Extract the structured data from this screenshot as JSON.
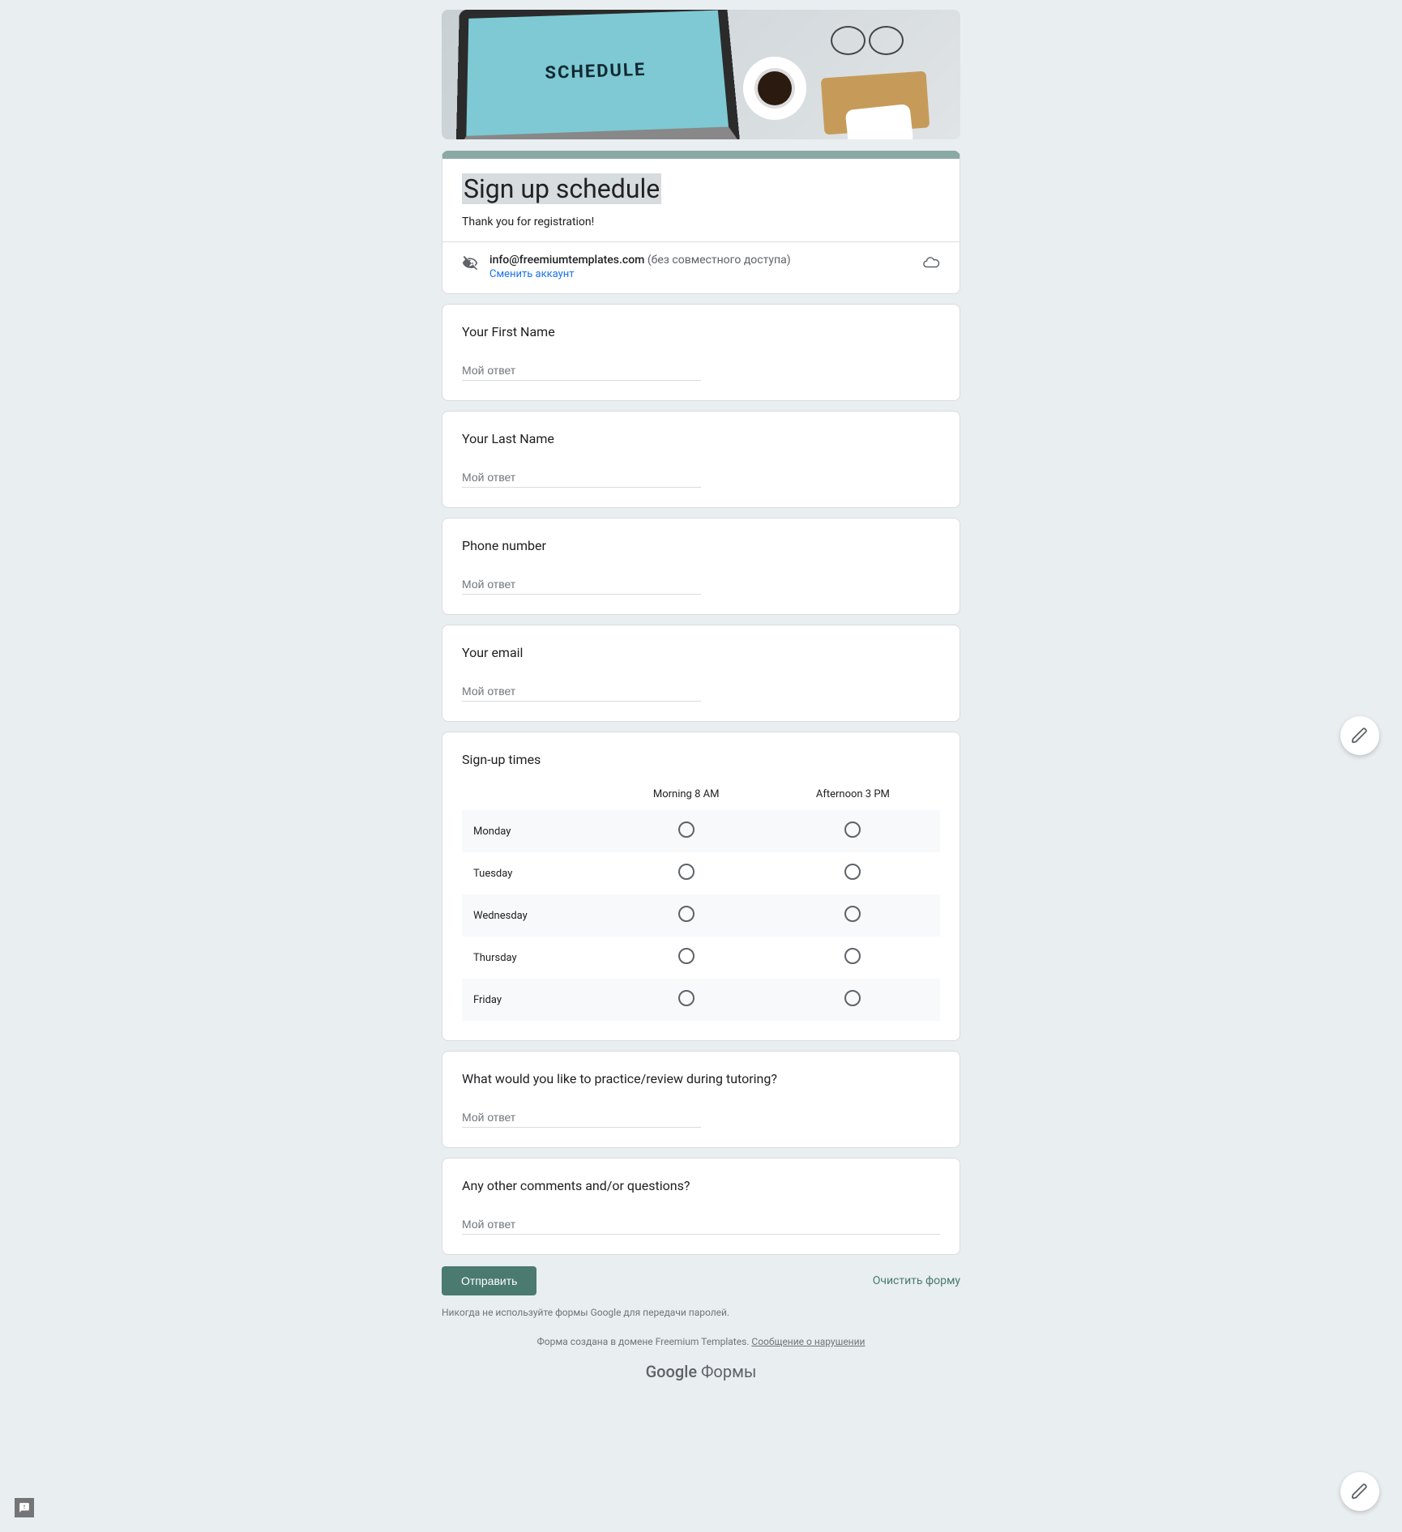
{
  "banner_text": "SCHEDULE",
  "header": {
    "title": "Sign up schedule",
    "description": "Thank you for registration!"
  },
  "account": {
    "email": "info@freemiumtemplates.com",
    "shared_note": "(без совместного доступа)",
    "switch_label": "Сменить аккаунт"
  },
  "questions": {
    "first_name": {
      "label": "Your First Name",
      "placeholder": "Мой ответ"
    },
    "last_name": {
      "label": "Your Last Name",
      "placeholder": "Мой ответ"
    },
    "phone": {
      "label": "Phone number",
      "placeholder": "Мой ответ"
    },
    "email": {
      "label": "Your email",
      "placeholder": "Мой ответ"
    },
    "practice": {
      "label": "What would you like to practice/review during tutoring?",
      "placeholder": "Мой ответ"
    },
    "comments": {
      "label": "Any other comments and/or questions?",
      "placeholder": "Мой ответ"
    }
  },
  "grid": {
    "label": "Sign-up times",
    "columns": [
      "Morning 8 AM",
      "Afternoon 3 PM"
    ],
    "rows": [
      "Monday",
      "Tuesday",
      "Wednesday",
      "Thursday",
      "Friday"
    ]
  },
  "footer": {
    "submit": "Отправить",
    "clear": "Очистить форму",
    "disclaimer": "Никогда не используйте формы Google для передачи паролей.",
    "domain_prefix": "Форма создана в домене Freemium Templates. ",
    "report_abuse": "Сообщение о нарушении",
    "logo_brand": "Google",
    "logo_product": " Формы"
  }
}
